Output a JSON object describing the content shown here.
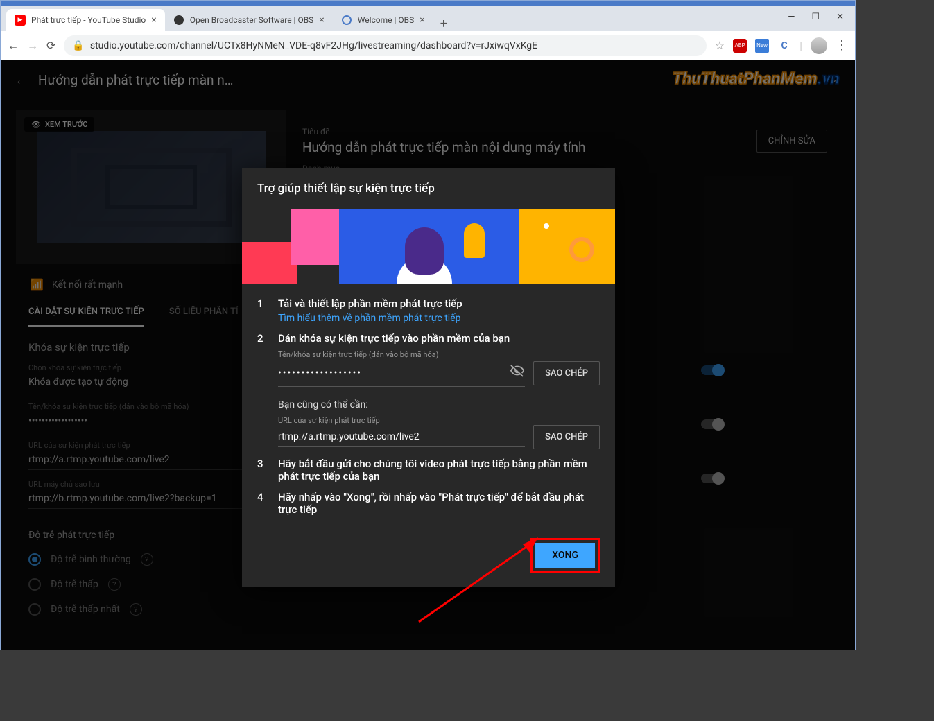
{
  "browser": {
    "tabs": [
      {
        "title": "Phát trực tiếp - YouTube Studio",
        "active": true
      },
      {
        "title": "Open Broadcaster Software | OBS",
        "active": false
      },
      {
        "title": "Welcome | OBS",
        "active": false
      }
    ],
    "url": "studio.youtube.com/channel/UCTx8HyNMeN_VDE-q8vF2JHg/livestreaming/dashboard?v=rJxiwqVxKgE",
    "extensions": {
      "abp": "ABP",
      "new": "New",
      "c": "C"
    }
  },
  "watermark": {
    "part1": "ThuThuatPhanMem",
    "part2": ".vn"
  },
  "header": {
    "title": "Hướng dẫn phát trực tiếp màn n…"
  },
  "preview": {
    "badge": "XEM TRƯỚC"
  },
  "connection": {
    "status": "Kết nối rất mạnh"
  },
  "title_block": {
    "label": "Tiêu đề",
    "value": "Hướng dẫn phát trực tiếp màn nội dung máy tính",
    "label2": "Danh mục",
    "edit_btn": "CHỈNH SỬA"
  },
  "tabs": {
    "settings": "CÀI ĐẶT SỰ KIỆN TRỰC TIẾP",
    "analytics": "SỐ LIỆU PHÂN TÍ"
  },
  "left": {
    "key_section_title": "Khóa sự kiện trực tiếp",
    "key_select_label": "Chọn khóa sự kiện trực tiếp",
    "key_select_value": "Khóa được tạo tự động",
    "key_name_label": "Tên/khóa sự kiện trực tiếp (dán vào bộ mã hóa)",
    "key_name_value": "••••••••••••••••••",
    "url_label": "URL của sự kiện phát trực tiếp",
    "url_value": "rtmp://a.rtmp.youtube.com/live2",
    "backup_label": "URL máy chủ sao lưu",
    "backup_value": "rtmp://b.rtmp.youtube.com/live2?backup=1",
    "latency_title": "Độ trễ phát trực tiếp",
    "latency_options": [
      "Độ trễ bình thường",
      "Độ trễ thấp",
      "Độ trễ thấp nhất"
    ]
  },
  "modal": {
    "title": "Trợ giúp thiết lập sự kiện trực tiếp",
    "steps": {
      "n1": "1",
      "t1": "Tải và thiết lập phần mềm phát trực tiếp",
      "link1": "Tìm hiểu thêm về phần mềm phát trực tiếp",
      "n2": "2",
      "t2": "Dán khóa sự kiện trực tiếp vào phần mềm của bạn",
      "key_label": "Tên/khóa sự kiện trực tiếp (dán vào bộ mã hóa)",
      "key_value": "••••••••••••••••••",
      "copy1": "SAO CHÉP",
      "may_need": "Bạn cũng có thể cần:",
      "url_label": "URL của sự kiện phát trực tiếp",
      "url_value": "rtmp://a.rtmp.youtube.com/live2",
      "copy2": "SAO CHÉP",
      "n3": "3",
      "t3": "Hãy bắt đầu gửi cho chúng tôi video phát trực tiếp bằng phần mềm phát trực tiếp của bạn",
      "n4": "4",
      "t4": "Hãy nhấp vào \"Xong\", rồi nhấp vào \"Phát trực tiếp\" để bắt đầu phát trực tiếp"
    },
    "done": "XONG"
  }
}
